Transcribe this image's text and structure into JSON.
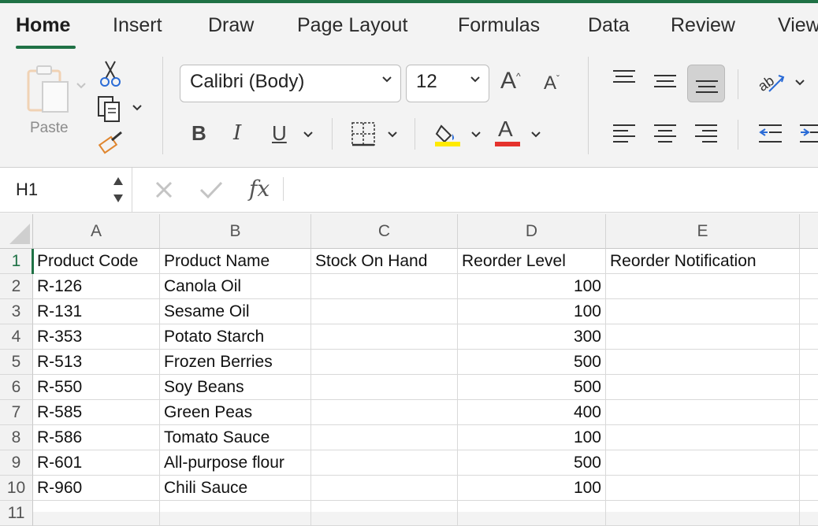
{
  "tabs": [
    "Home",
    "Insert",
    "Draw",
    "Page Layout",
    "Formulas",
    "Data",
    "Review",
    "View"
  ],
  "ribbon": {
    "paste_label": "Paste",
    "font_name": "Calibri (Body)",
    "font_size": "12",
    "bold_label": "B",
    "italic_label": "I",
    "underline_label": "U",
    "grow_label": "A",
    "shrink_label": "A",
    "font_color_label": "A",
    "highlight_color": "#ffea00",
    "font_color": "#e5322d"
  },
  "formula_bar": {
    "name_box": "H1",
    "fx_label": "fx",
    "formula": ""
  },
  "sheet": {
    "columns": [
      "A",
      "B",
      "C",
      "D",
      "E"
    ],
    "row_numbers": [
      "1",
      "2",
      "3",
      "4",
      "5",
      "6",
      "7",
      "8",
      "9",
      "10",
      "11"
    ],
    "rows": [
      [
        "Product Code",
        "Product Name",
        "Stock On Hand",
        "Reorder Level",
        "Reorder Notification"
      ],
      [
        "R-126",
        "Canola Oil",
        "",
        "100",
        ""
      ],
      [
        "R-131",
        "Sesame Oil",
        "",
        "100",
        ""
      ],
      [
        "R-353",
        "Potato Starch",
        "",
        "300",
        ""
      ],
      [
        "R-513",
        "Frozen Berries",
        "",
        "500",
        ""
      ],
      [
        "R-550",
        "Soy Beans",
        "",
        "500",
        ""
      ],
      [
        "R-585",
        "Green Peas",
        "",
        "400",
        ""
      ],
      [
        "R-586",
        "Tomato Sauce",
        "",
        "100",
        ""
      ],
      [
        "R-601",
        "All-purpose flour",
        "",
        "500",
        ""
      ],
      [
        "R-960",
        "Chili Sauce",
        "",
        "100",
        ""
      ]
    ]
  }
}
